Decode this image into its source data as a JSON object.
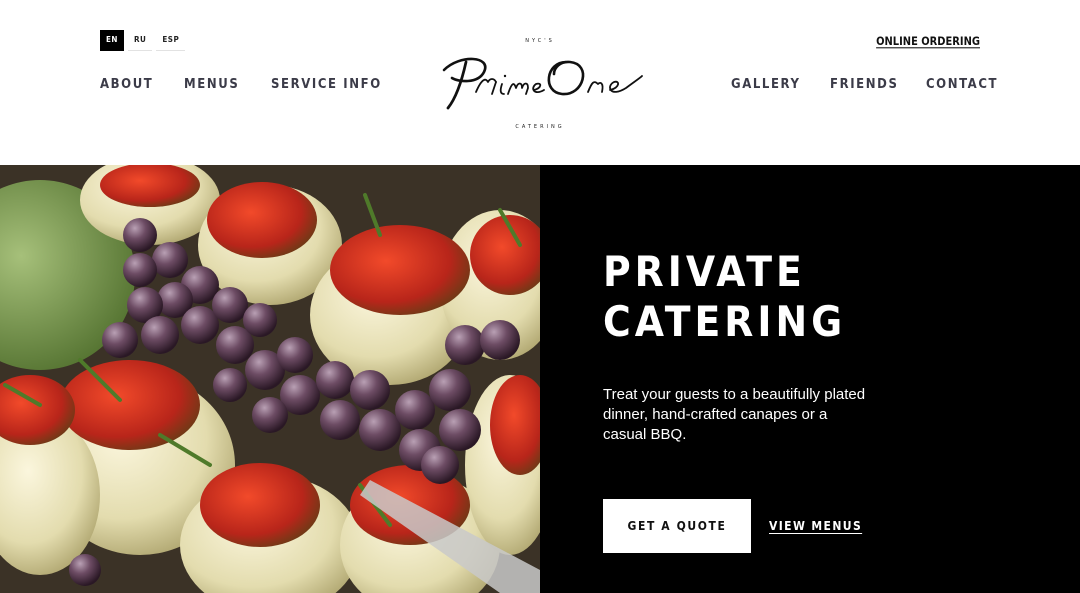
{
  "languages": [
    {
      "label": "EN",
      "active": true
    },
    {
      "label": "RU",
      "active": false
    },
    {
      "label": "ESP",
      "active": false
    }
  ],
  "header": {
    "online_ordering": "ONLINE ORDERING",
    "nav_left": [
      "ABOUT",
      "MENUS",
      "SERVICE INFO"
    ],
    "nav_right": [
      "GALLERY",
      "FRIENDS",
      "CONTACT"
    ]
  },
  "logo": {
    "tagline_top": "NYC'S",
    "wordmark": "PrimeOne",
    "tagline_bottom": "CATERING"
  },
  "hero": {
    "title_line1": "PRIVATE",
    "title_line2": "CATERING",
    "description": "Treat your guests to a beautifully plated dinner, hand-crafted canapes or a casual BBQ.",
    "quote_button": "GET A QUOTE",
    "menus_link": "VIEW MENUS",
    "image_alt": "artichoke-hearts-with-grapes-photo"
  },
  "colors": {
    "nav_text": "#3b3b48",
    "panel_bg": "#000000",
    "accent_white": "#ffffff"
  }
}
